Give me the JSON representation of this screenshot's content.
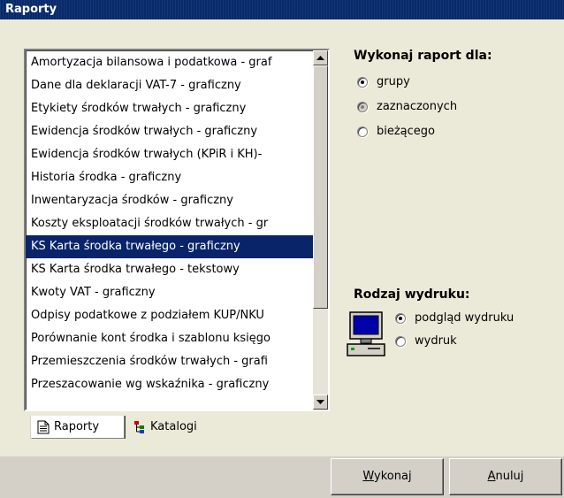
{
  "window": {
    "title": "Raporty"
  },
  "reports": {
    "items": [
      "Amortyzacja bilansowa i podatkowa - graf",
      "Dane dla deklaracji VAT-7 - graficzny",
      "Etykiety środków trwałych - graficzny",
      "Ewidencja środków trwałych - graficzny",
      "Ewidencja środków trwałych (KPiR i KH)-",
      "Historia środka - graficzny",
      "Inwentaryzacja środków - graficzny",
      "Koszty eksploatacji środków trwałych - gr",
      "KS Karta środka trwałego - graficzny",
      "KS Karta środka trwałego - tekstowy",
      "Kwoty VAT - graficzny",
      "Odpisy podatkowe z podziałem KUP/NKU",
      "Porównanie kont środka i szablonu księgo",
      "Przemieszczenia środków trwałych - grafi",
      "Przeszacowanie wg wskaźnika - graficzny"
    ],
    "selected_index": 8
  },
  "tabs": {
    "raporty": "Raporty",
    "katalogi": "Katalogi"
  },
  "execute_for": {
    "label": "Wykonaj raport dla:",
    "options": [
      "grupy",
      "zaznaczonych",
      "bieżącego"
    ],
    "selected": "grupy"
  },
  "print_type": {
    "label": "Rodzaj wydruku:",
    "options": [
      "podgląd wydruku",
      "wydruk"
    ],
    "selected": "podgląd wydruku"
  },
  "buttons": {
    "run_accel": "W",
    "run_rest": "ykonaj",
    "cancel_accel": "A",
    "cancel_rest": "nuluj"
  },
  "colors": {
    "title_bar": "#082a6a",
    "selection": "#0a246a",
    "panel": "#ebe9d8"
  },
  "icons": {
    "scroll_up": "arrow-up-icon",
    "scroll_down": "arrow-down-icon",
    "tab_raporty": "document-icon",
    "tab_katalogi": "tree-icon",
    "print_device": "computer-icon"
  }
}
